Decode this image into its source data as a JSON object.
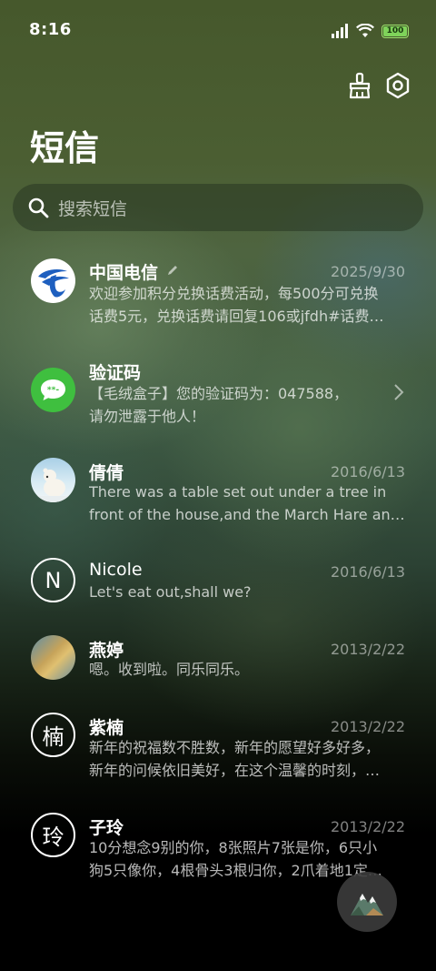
{
  "status_bar": {
    "time": "8:16",
    "battery": "100"
  },
  "header": {
    "title": "短信"
  },
  "search": {
    "placeholder": "搜索短信"
  },
  "conversations": [
    {
      "name": "中国电信",
      "date": "2025/9/30",
      "line1": "欢迎参加积分兑换话费活动，每500分可兑换",
      "line2": "话费5元，兑换话费请回复106或jfdh#话费…",
      "avatar_icon": "china-telecom-logo-icon",
      "name_icon": "pencil-icon"
    },
    {
      "name": "验证码",
      "date": "",
      "line1": "【毛绒盒子】您的验证码为：047588，",
      "line2": "请勿泄露于他人！",
      "avatar_icon": "message-bubble-icon",
      "chevron": "chevron-right-icon"
    },
    {
      "name": "倩倩",
      "date": "2016/6/13",
      "line1": "There was a table set out under a tree in",
      "line2": "front of the house,and the March Hare an…",
      "avatar_icon": "polar-bear-photo"
    },
    {
      "name": "Nicole",
      "date": "2016/6/13",
      "line1": "Let's eat out,shall we?",
      "avatar_letter": "N"
    },
    {
      "name": "燕婷",
      "date": "2013/2/22",
      "line1": "嗯。收到啦。同乐同乐。",
      "avatar_icon": "landscape-photo"
    },
    {
      "name": "紫楠",
      "date": "2013/2/22",
      "line1": "新年的祝福数不胜数，新年的愿望好多好多，",
      "line2": "新年的问候依旧美好，在这个温馨的时刻，…",
      "avatar_letter": "楠"
    },
    {
      "name": "子玲",
      "date": "2013/2/22",
      "line1": "10分想念9别的你，8张照片7张是你，6只小",
      "line2": "狗5只像你，4根骨头3根归你，2爪着地1定…",
      "avatar_letter": "玲"
    }
  ],
  "fab": {
    "icon": "mountain-icon"
  },
  "colors": {
    "accent_green": "#3fbf3f",
    "telecom_blue": "#1e5fbf"
  }
}
